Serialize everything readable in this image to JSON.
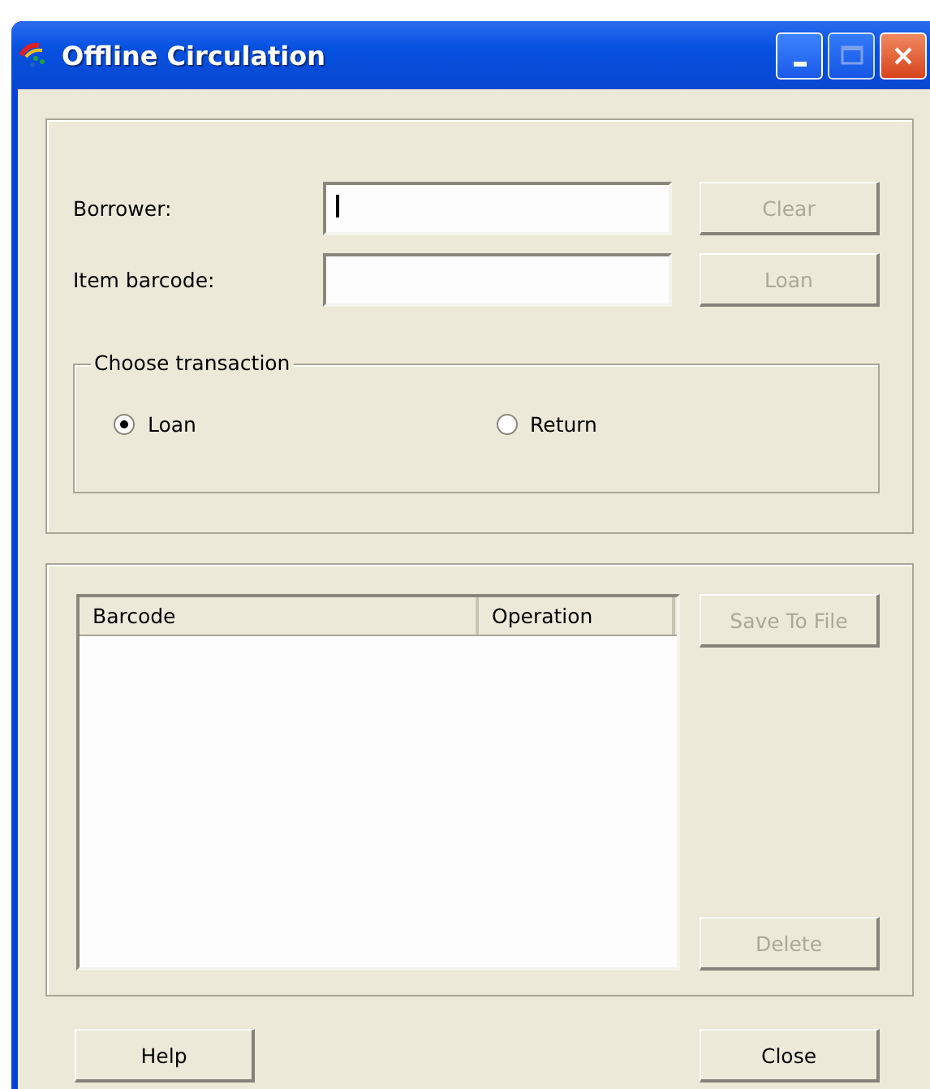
{
  "window": {
    "title": "Offline Circulation"
  },
  "fields": [
    {
      "label": "Borrower:",
      "focused": true,
      "button": {
        "label": "Clear",
        "disabled": true
      }
    },
    {
      "label": "Item barcode:",
      "focused": false,
      "button": {
        "label": "Loan",
        "disabled": true
      }
    }
  ],
  "transaction": {
    "title": "Choose transaction",
    "options": [
      {
        "label": "Loan",
        "selected": true
      },
      {
        "label": "Return",
        "selected": false
      }
    ]
  },
  "list": {
    "columns": [
      "Barcode",
      "Operation"
    ]
  },
  "list_buttons": [
    {
      "label": "Save To File",
      "disabled": true
    },
    {
      "label": "Delete",
      "disabled": true
    }
  ],
  "footer_buttons": [
    {
      "label": "Help",
      "disabled": false
    },
    {
      "label": "Close",
      "disabled": false
    }
  ]
}
